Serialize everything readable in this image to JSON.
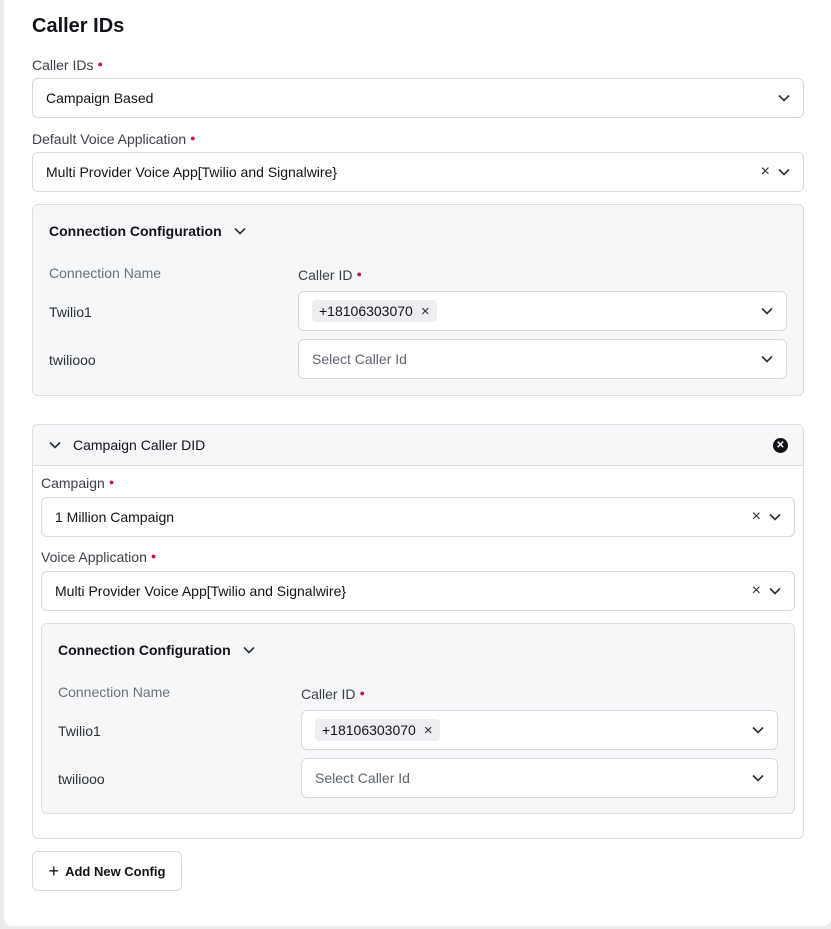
{
  "header": {
    "title": "Caller IDs"
  },
  "caller_ids_field": {
    "label": "Caller IDs",
    "value": "Campaign Based"
  },
  "default_voice_app": {
    "label": "Default Voice Application",
    "value": "Multi Provider Voice App[Twilio and Signalwire}"
  },
  "connection_config": {
    "title": "Connection Configuration",
    "col_name": "Connection Name",
    "col_caller": "Caller ID",
    "rows": [
      {
        "name": "Twilio1",
        "tag": "+18106303070"
      },
      {
        "name": "twiliooo",
        "placeholder": "Select Caller Id"
      }
    ]
  },
  "campaign_panel": {
    "title": "Campaign Caller DID",
    "campaign": {
      "label": "Campaign",
      "value": "1 Million Campaign"
    },
    "voice_app": {
      "label": "Voice Application",
      "value": "Multi Provider Voice App[Twilio and Signalwire}"
    },
    "connection_config": {
      "title": "Connection Configuration",
      "col_name": "Connection Name",
      "col_caller": "Caller ID",
      "rows": [
        {
          "name": "Twilio1",
          "tag": "+18106303070"
        },
        {
          "name": "twiliooo",
          "placeholder": "Select Caller Id"
        }
      ]
    }
  },
  "add_button": {
    "label": "Add New Config"
  },
  "colors": {
    "required": "#c4124a",
    "card_bg": "#f6f7f8",
    "border": "#d7d9de"
  }
}
